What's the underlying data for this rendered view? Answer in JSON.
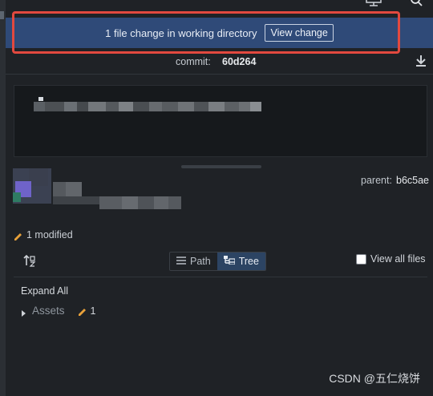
{
  "banner": {
    "message": "1 file change in working directory",
    "view_change_label": "View change"
  },
  "commit": {
    "label": "commit:",
    "sha": "60d264"
  },
  "author": {
    "parent_label": "parent:",
    "parent_sha": "b6c5ae"
  },
  "changes": {
    "summary": "1 modified"
  },
  "view_toggle": {
    "path_label": "Path",
    "tree_label": "Tree",
    "active": "Tree"
  },
  "view_all_files": {
    "label": "View all files",
    "checked": false
  },
  "tree": {
    "expand_all_label": "Expand All",
    "items": [
      {
        "name": "Assets",
        "modified_count": "1"
      }
    ]
  },
  "watermark": "CSDN @五仁烧饼",
  "colors": {
    "banner_bg": "#2f4a78",
    "highlight": "#e2493f",
    "pencil": "#e8a13a",
    "panel_bg": "#1f2226"
  },
  "icons": {
    "top": [
      "monitor-icon",
      "search-icon"
    ],
    "download": "download-icon",
    "sort": "sort-icon",
    "pencil": "pencil-icon"
  }
}
